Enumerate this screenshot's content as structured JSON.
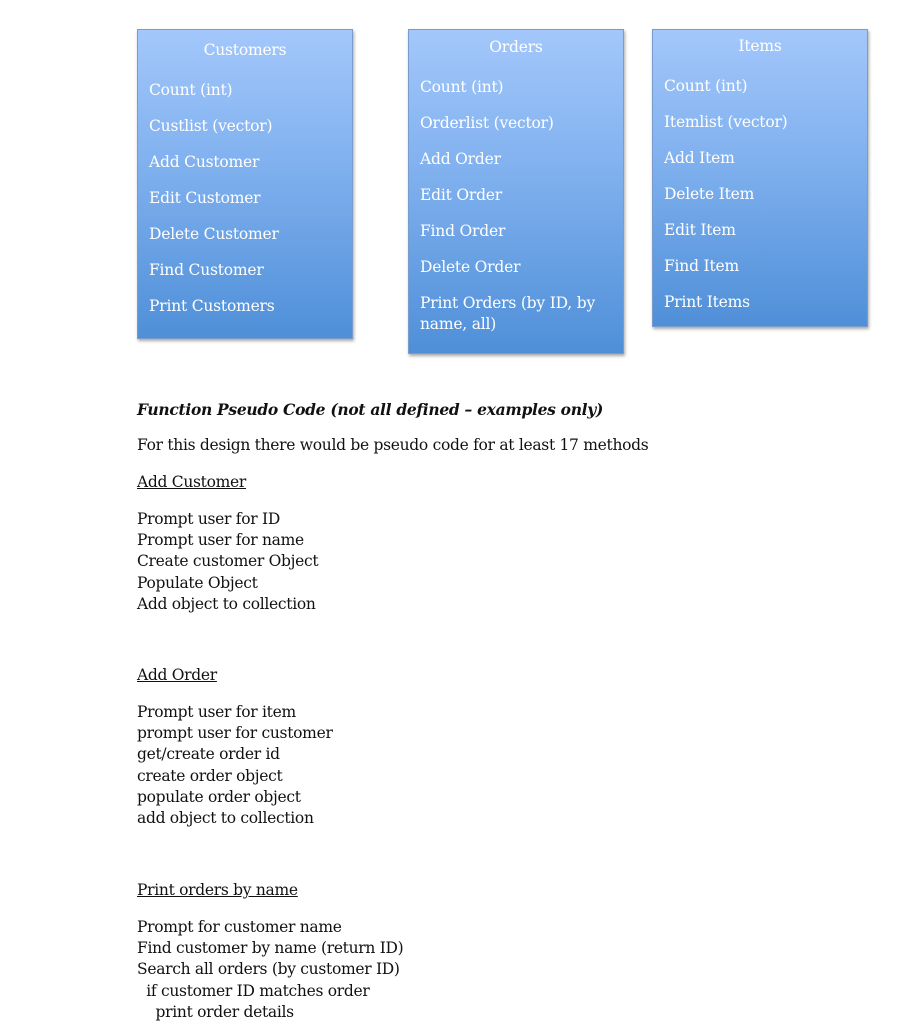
{
  "boxes": {
    "customers": {
      "title": "Customers",
      "items": [
        "Count (int)",
        "Custlist (vector)",
        "Add Customer",
        "Edit Customer",
        "Delete Customer",
        "Find Customer",
        "Print Customers"
      ]
    },
    "orders": {
      "title": "Orders",
      "items": [
        "Count (int)",
        "Orderlist (vector)",
        "Add Order",
        "Edit Order",
        "Find Order",
        "Delete Order",
        "Print Orders (by ID, by name, all)"
      ]
    },
    "items": {
      "title": "Items",
      "items": [
        "Count (int)",
        "Itemlist (vector)",
        "Add Item",
        "Delete Item",
        "Edit Item",
        "Find Item",
        "Print Items"
      ]
    }
  },
  "colors": {
    "box_top": "#a3c7fb",
    "box_bottom": "#4f8fd8",
    "box_text": "#ffffff"
  },
  "document": {
    "heading": "Function Pseudo Code (not all defined – examples only)",
    "intro": "For this design there would be pseudo code for at least 17 methods",
    "sections": [
      {
        "title": "Add Customer",
        "lines": [
          "Prompt user for ID",
          "Prompt user for name",
          "Create customer Object",
          "Populate Object",
          "Add object to collection"
        ]
      },
      {
        "title": "Add Order",
        "lines": [
          "Prompt user for item",
          "prompt user for customer",
          "get/create order id",
          "create order object",
          "populate order object",
          "add object to collection"
        ]
      },
      {
        "title": "Print orders by name",
        "lines": [
          "Prompt for customer name",
          "Find customer by name (return ID)",
          "Search all orders (by customer ID)",
          "  if customer ID matches order",
          "    print order details"
        ]
      }
    ]
  }
}
